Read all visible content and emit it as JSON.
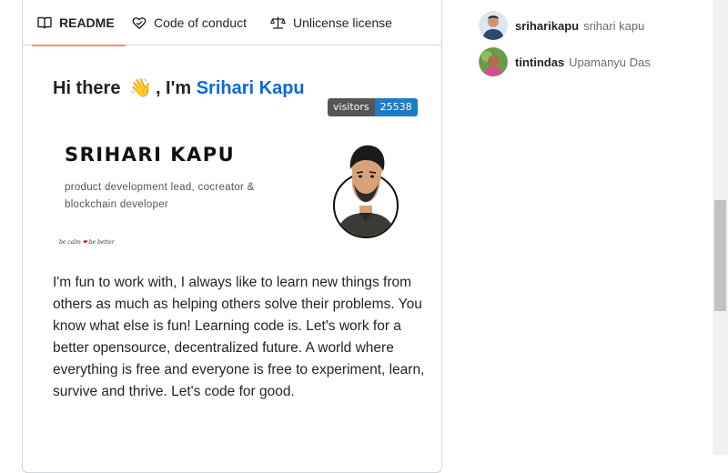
{
  "tabs": {
    "readme": "README",
    "code_of_conduct": "Code of conduct",
    "license": "Unlicense license"
  },
  "readme": {
    "greeting_prefix": "Hi there",
    "greeting_wave": "👋",
    "greeting_mid": ", I'm",
    "greeting_name": "Srihari Kapu",
    "visitors_label": "visitors",
    "visitors_count": "25538",
    "banner_name": "SRIHARI KAPU",
    "banner_role": "product development lead, cocreator & blockchain developer",
    "banner_sign_left": "be calm",
    "banner_sign_heart": "❤",
    "banner_sign_right": "be better",
    "bio": "I'm fun to work with, I always like to learn new things from others as much as helping others solve their problems. You know what else is fun! Learning code is. Let's work for a better opensource, decentralized future. A world where everything is free and everyone is free to experiment, learn, survive and thrive. Let's code for good."
  },
  "contributors": [
    {
      "login": "sriharikapu",
      "name": "srihari kapu"
    },
    {
      "login": "tintindas",
      "name": "Upamanyu Das"
    }
  ],
  "colors": {
    "link": "#0969da",
    "tab_underline": "#fd8c73",
    "badge_left": "#555555",
    "badge_right": "#1f7bc1"
  },
  "icons": [
    "book-icon",
    "heart-shield-icon",
    "scale-icon"
  ]
}
